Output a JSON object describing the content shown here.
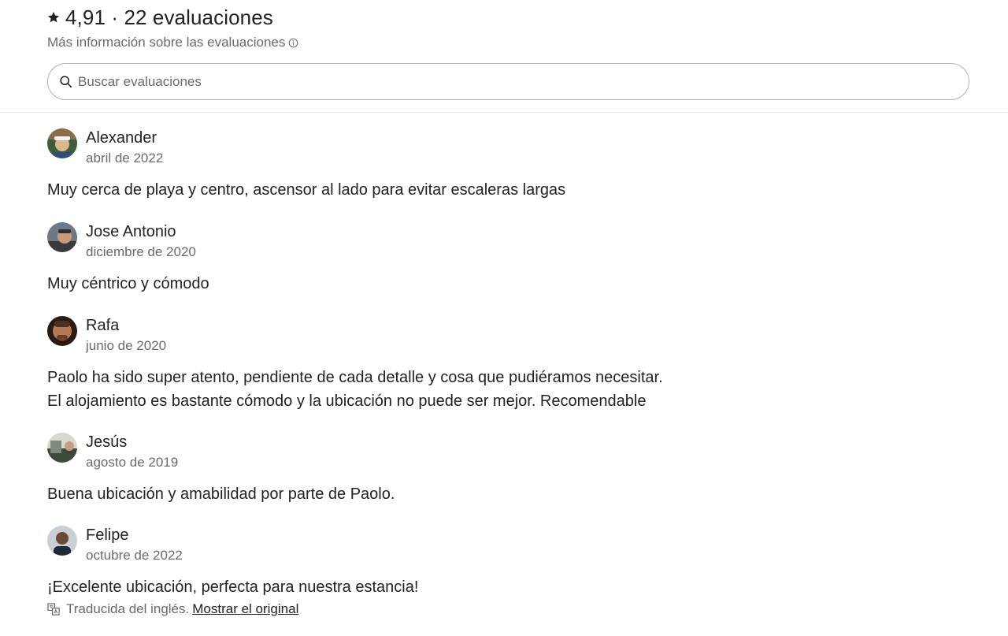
{
  "header": {
    "rating_value": "4,91",
    "separator": "·",
    "review_count_label": "22 evaluaciones",
    "more_info_label": "Más información sobre las evaluaciones"
  },
  "search": {
    "placeholder": "Buscar evaluaciones",
    "value": ""
  },
  "reviews": [
    {
      "name": "Alexander",
      "date": "abril de 2022",
      "text": "Muy cerca de playa y centro, ascensor al lado para evitar escaleras largas",
      "avatar_colors": [
        "#8a6d4a",
        "#d9b88f",
        "#3f5d3a"
      ]
    },
    {
      "name": "Jose Antonio",
      "date": "diciembre de 2020",
      "text": "Muy céntrico y cómodo",
      "avatar_colors": [
        "#6b7a86",
        "#c99a7c",
        "#2f2f2f"
      ]
    },
    {
      "name": "Rafa",
      "date": "junio de 2020",
      "text": "Paolo ha sido super atento, pendiente de cada detalle y cosa que pudiéramos necesitar.\nEl alojamiento es bastante cómodo y la ubicación no puede ser mejor. Recomendable",
      "avatar_colors": [
        "#4a2f22",
        "#b57a55",
        "#2a1a12"
      ]
    },
    {
      "name": "Jesús",
      "date": "agosto de 2019",
      "text": "Buena ubicación y amabilidad por parte de Paolo.",
      "avatar_colors": [
        "#7f8a7a",
        "#d8d8d2",
        "#3d4a3a"
      ]
    },
    {
      "name": "Felipe",
      "date": "octubre de 2022",
      "text": "¡Excelente ubicación, perfecta para nuestra estancia!",
      "avatar_colors": [
        "#c9cfd6",
        "#6b4a35",
        "#1f2a36"
      ],
      "translation": {
        "note": "Traducida del inglés.",
        "link": "Mostrar el original"
      }
    }
  ]
}
